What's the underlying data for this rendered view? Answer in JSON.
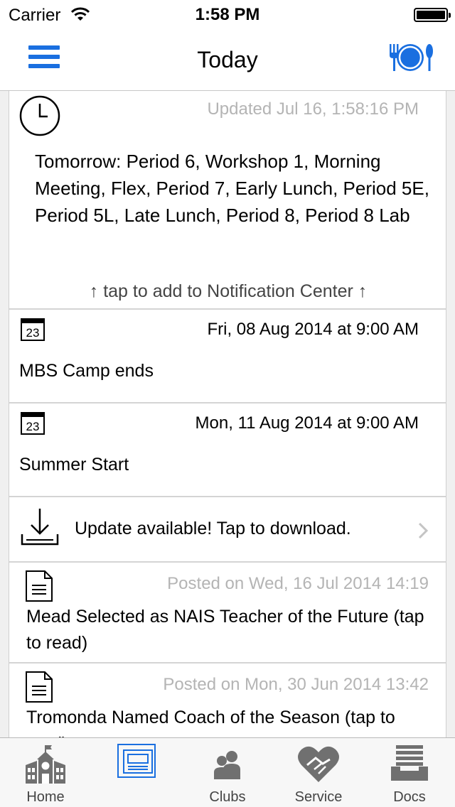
{
  "status": {
    "carrier": "Carrier",
    "time": "1:58 PM"
  },
  "nav": {
    "title": "Today",
    "menu_icon": "hamburger-menu-icon",
    "dining_icon": "dining-icon"
  },
  "schedule": {
    "updated": "Updated Jul 16, 1:58:16 PM",
    "text": "Tomorrow: Period 6, Workshop 1, Morning Meeting, Flex, Period 7, Early Lunch, Period 5E, Period 5L, Late Lunch, Period 8, Period 8 Lab",
    "tap_note": "↑ tap to add to Notification Center ↑"
  },
  "events": [
    {
      "cal_day": "23",
      "date": "Fri, 08 Aug 2014 at 9:00 AM",
      "name": "MBS Camp ends"
    },
    {
      "cal_day": "23",
      "date": "Mon, 11 Aug 2014 at 9:00 AM",
      "name": "Summer Start"
    }
  ],
  "update": {
    "text": "Update available! Tap to download."
  },
  "news": [
    {
      "posted": "Posted on Wed, 16 Jul 2014 14:19",
      "title": "Mead Selected as NAIS Teacher of the Future (tap to read)"
    },
    {
      "posted": "Posted on Mon, 30 Jun 2014 13:42",
      "title": "Tromonda Named Coach of the Season (tap to read)"
    }
  ],
  "tabs": [
    {
      "label": "Home",
      "icon": "school-house-icon"
    },
    {
      "label": "",
      "icon": "news-board-icon",
      "selected": true
    },
    {
      "label": "Clubs",
      "icon": "people-icon"
    },
    {
      "label": "Service",
      "icon": "heart-handshake-icon"
    },
    {
      "label": "Docs",
      "icon": "document-tray-icon"
    }
  ],
  "colors": {
    "accent": "#1a6fe0",
    "gray_text": "#b4b4b4",
    "tab_icon": "#707070"
  }
}
